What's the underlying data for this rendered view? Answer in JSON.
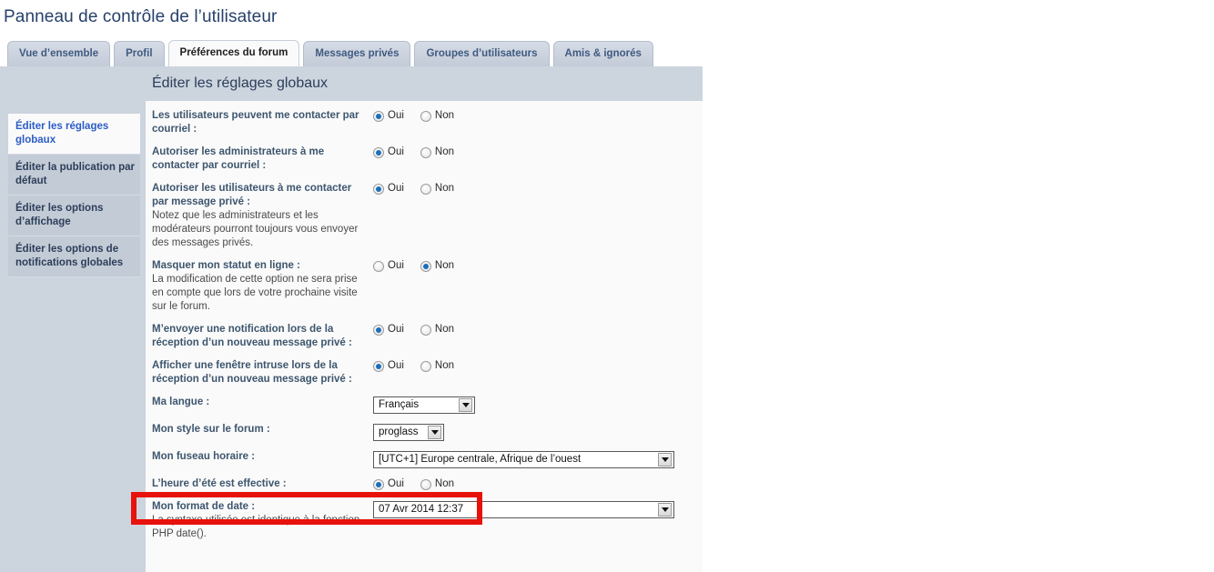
{
  "page": {
    "title": "Panneau de contrôle de l’utilisateur"
  },
  "tabs": [
    {
      "label": "Vue d’ensemble",
      "active": false
    },
    {
      "label": "Profil",
      "active": false
    },
    {
      "label": "Préférences du forum",
      "active": true
    },
    {
      "label": "Messages privés",
      "active": false
    },
    {
      "label": "Groupes d’utilisateurs",
      "active": false
    },
    {
      "label": "Amis & ignorés",
      "active": false
    }
  ],
  "sidebar": {
    "items": [
      {
        "label": "Éditer les réglages globaux",
        "active": true
      },
      {
        "label": "Éditer la publication par défaut",
        "active": false
      },
      {
        "label": "Éditer les options d’affichage",
        "active": false
      },
      {
        "label": "Éditer les options de notifications globales",
        "active": false
      }
    ]
  },
  "panel": {
    "heading": "Éditer les réglages globaux"
  },
  "radio_labels": {
    "yes": "Oui",
    "no": "Non"
  },
  "settings": [
    {
      "label": "Les utilisateurs peuvent me contacter par courriel :",
      "description": "",
      "type": "radio",
      "value": "Oui"
    },
    {
      "label": "Autoriser les administrateurs à me contacter par courriel :",
      "description": "",
      "type": "radio",
      "value": "Oui"
    },
    {
      "label": "Autoriser les utilisateurs à me contacter par message privé :",
      "description": "Notez que les administrateurs et les modérateurs pourront toujours vous envoyer des messages privés.",
      "type": "radio",
      "value": "Oui"
    },
    {
      "label": "Masquer mon statut en ligne :",
      "description": "La modification de cette option ne sera prise en compte que lors de votre prochaine visite sur le forum.",
      "type": "radio",
      "value": "Non"
    },
    {
      "label": "M’envoyer une notification lors de la réception d’un nouveau message privé :",
      "description": "",
      "type": "radio",
      "value": "Oui"
    },
    {
      "label": "Afficher une fenêtre intruse lors de la réception d’un nouveau message privé :",
      "description": "",
      "type": "radio",
      "value": "Oui"
    },
    {
      "label": "Ma langue :",
      "description": "",
      "type": "select",
      "value": "Français"
    },
    {
      "label": "Mon style sur le forum :",
      "description": "",
      "type": "select",
      "value": "proglass"
    },
    {
      "label": "Mon fuseau horaire :",
      "description": "",
      "type": "select",
      "value": "[UTC+1] Europe centrale, Afrique de l’ouest"
    },
    {
      "label": "L’heure d’été est effective :",
      "description": "",
      "type": "radio",
      "value": "Oui",
      "highlighted": true
    },
    {
      "label": "Mon format de date :",
      "description": "La syntaxe utilisée est identique à la fonction PHP date().",
      "type": "select",
      "value": "07 Avr 2014 12:37"
    }
  ],
  "colors": {
    "title": "#26406b",
    "panel_bg": "#ccd4de",
    "content_bg": "#fafafa",
    "active_nav_text": "#2b5cc6",
    "highlight": "#e8120c",
    "radio_dot": "#1b6fbd"
  }
}
